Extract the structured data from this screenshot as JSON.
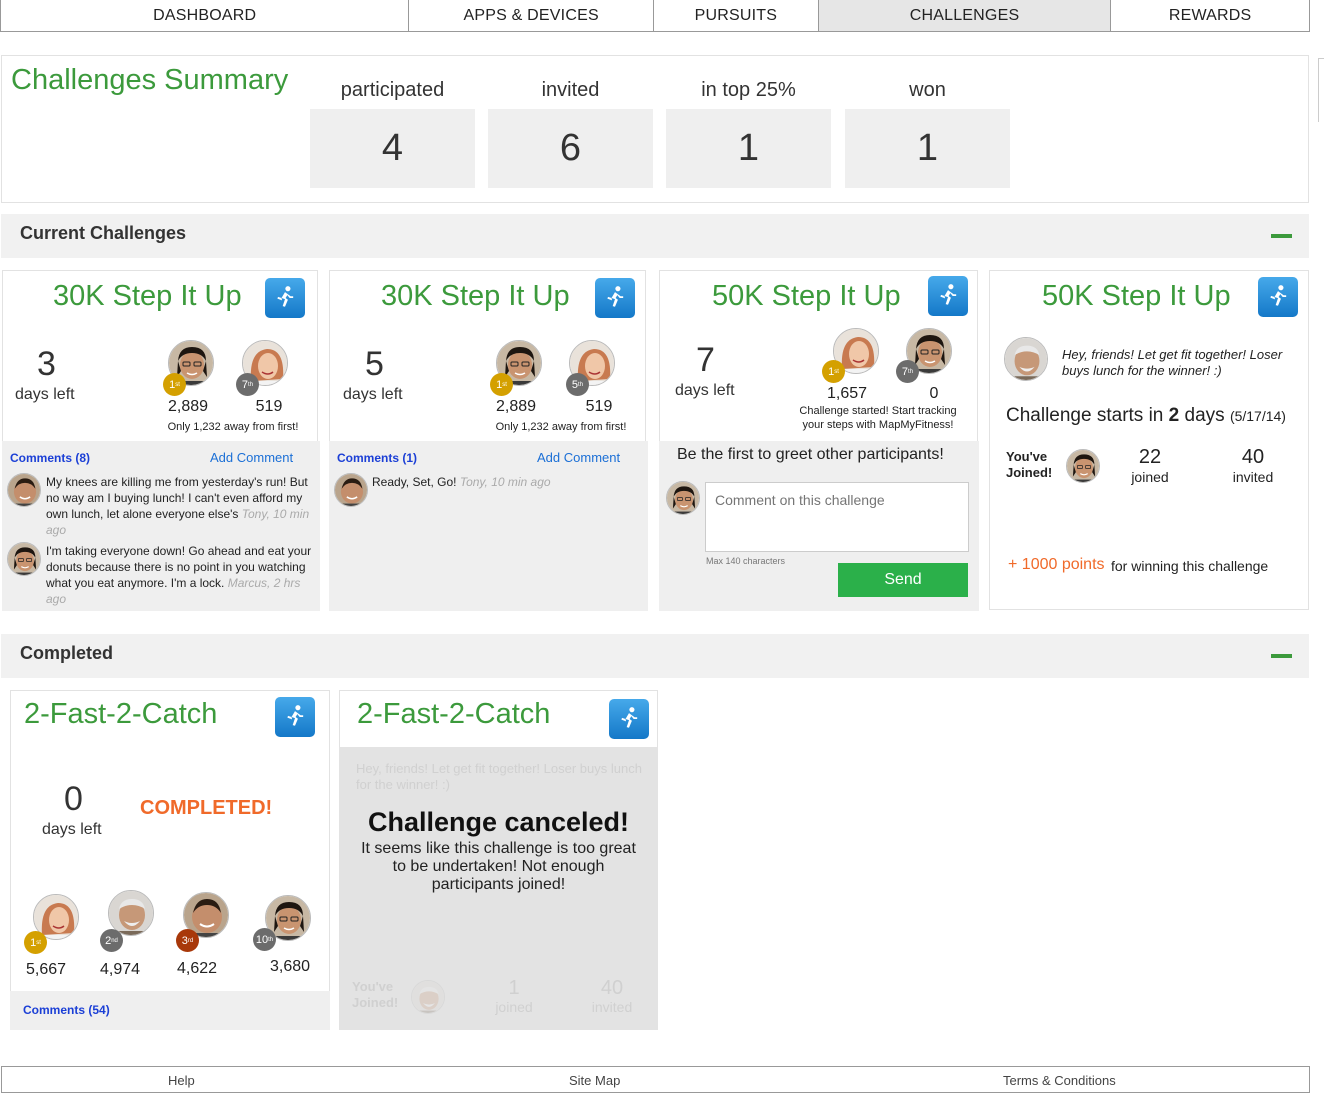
{
  "nav": {
    "tabs": [
      "DASHBOARD",
      "APPS & DEVICES",
      "PURSUITS",
      "CHALLENGES",
      "REWARDS"
    ],
    "active": "CHALLENGES"
  },
  "summary": {
    "title": "Challenges Summary",
    "stats": [
      {
        "label": "participated",
        "value": "4"
      },
      {
        "label": "invited",
        "value": "6"
      },
      {
        "label": "in top 25%",
        "value": "1"
      },
      {
        "label": "won",
        "value": "1"
      }
    ]
  },
  "current": {
    "title": "Current Challenges",
    "cards": [
      {
        "title": "30K Step It Up",
        "days": "3",
        "days_label": "days left",
        "p1_rank": "1",
        "p1_rank_suffix": "st",
        "p1_score": "2,889",
        "p2_rank": "7",
        "p2_rank_suffix": "th",
        "p2_score": "519",
        "note": "Only 1,232 away from first!",
        "comments_link": "Comments (8)",
        "add_comment": "Add Comment",
        "comments": [
          {
            "text": "My knees are killing me from yesterday's run! But no way am I buying lunch! I can't even afford my own lunch, let alone everyone else's",
            "meta": "Tony, 10 min ago"
          },
          {
            "text": "I'm taking everyone down! Go ahead and eat your donuts because there is no point in you watching what you eat anymore. I'm a lock.",
            "meta": "Marcus, 2 hrs ago"
          }
        ]
      },
      {
        "title": "30K Step It Up",
        "days": "5",
        "days_label": "days left",
        "p1_rank": "1",
        "p1_rank_suffix": "st",
        "p1_score": "2,889",
        "p2_rank": "5",
        "p2_rank_suffix": "th",
        "p2_score": "519",
        "note": "Only 1,232 away from first!",
        "comments_link": "Comments (1)",
        "add_comment": "Add Comment",
        "comments": [
          {
            "text": "Ready, Set, Go!",
            "meta": "Tony, 10 min ago"
          }
        ]
      },
      {
        "title": "50K Step It Up",
        "days": "7",
        "days_label": "days left",
        "p1_rank": "1",
        "p1_rank_suffix": "st",
        "p1_score": "1,657",
        "p2_rank": "7",
        "p2_rank_suffix": "th",
        "p2_score": "0",
        "note": "Challenge started! Start tracking your steps with MapMyFitness!",
        "greet": "Be the first to greet other participants!",
        "comment_placeholder": "Comment on this challenge",
        "max_chars": "Max 140 characters",
        "send": "Send"
      },
      {
        "title": "50K Step It Up",
        "message": "Hey, friends! Let get fit together! Loser buys lunch for the winner! :)",
        "starts_prefix": "Challenge starts in ",
        "starts_days": "2",
        "starts_suffix": " days",
        "starts_date": "(5/17/14)",
        "joined_label": "You've Joined!",
        "joined_count": "22",
        "joined_word": "joined",
        "invited_count": "40",
        "invited_word": "invited",
        "points": "+ 1000 points",
        "points_suffix": "for winning this  challenge"
      }
    ]
  },
  "completed": {
    "title": "Completed",
    "cards": [
      {
        "title": "2-Fast-2-Catch",
        "days": "0",
        "days_label": "days left",
        "status": "COMPLETED!",
        "participants": [
          {
            "rank": "1",
            "suffix": "st",
            "score": "5,667"
          },
          {
            "rank": "2",
            "suffix": "nd",
            "score": "4,974"
          },
          {
            "rank": "3",
            "suffix": "rd",
            "score": "4,622"
          },
          {
            "rank": "10",
            "suffix": "th",
            "score": "3,680"
          }
        ],
        "comments_link": "Comments (54)"
      },
      {
        "title": "2-Fast-2-Catch",
        "ghost_message": "Hey, friends! Let get fit together! Loser buys lunch for the winner! :)",
        "canceled_title": "Challenge canceled!",
        "canceled_text": "It seems like this challenge is too great to be undertaken! Not enough participants joined!",
        "ghost_joined_label": "You've Joined!",
        "ghost_joined": "1",
        "ghost_joined_word": "joined",
        "ghost_invited": "40",
        "ghost_invited_word": "invited"
      }
    ]
  },
  "footer": {
    "help": "Help",
    "sitemap": "Site Map",
    "terms": "Terms & Conditions"
  },
  "colors": {
    "accent_green": "#3c9a3c",
    "icon_blue": "#1e88d8",
    "orange": "#f06a2a",
    "link_blue": "#1b3fd6"
  }
}
